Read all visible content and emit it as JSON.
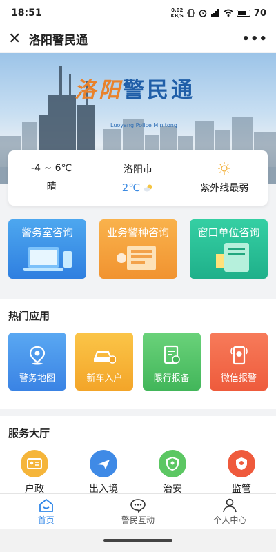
{
  "status": {
    "time": "18:51",
    "net_speed_value": "0.02",
    "net_speed_unit": "KB/S",
    "battery": "70"
  },
  "titlebar": {
    "title": "洛阳警民通"
  },
  "banner": {
    "title_orange": "洛阳",
    "title_blue": "警民通",
    "subtitle": "Luoyang Police Minitong"
  },
  "weather": {
    "temp_range": "-4 ~ 6℃",
    "condition": "晴",
    "city": "洛阳市",
    "current_temp": "2℃",
    "uv": "紫外线最弱"
  },
  "quick_cards": [
    {
      "label": "警务室咨询",
      "color": "#3a8fe7"
    },
    {
      "label": "业务警种咨询",
      "color": "#f4a13c"
    },
    {
      "label": "窗口单位咨询",
      "color": "#27bf96"
    }
  ],
  "hot_apps": {
    "title": "热门应用",
    "items": [
      {
        "label": "警务地图",
        "icon": "map-pin-icon"
      },
      {
        "label": "新车入户",
        "icon": "car-icon"
      },
      {
        "label": "限行报备",
        "icon": "clipboard-icon"
      },
      {
        "label": "微信报警",
        "icon": "phone-alert-icon"
      }
    ]
  },
  "service_hall": {
    "title": "服务大厅",
    "items": [
      {
        "label": "户政",
        "color": "#f5b53a"
      },
      {
        "label": "出入境",
        "color": "#3f8ae6"
      },
      {
        "label": "治安",
        "color": "#5cc763"
      },
      {
        "label": "监管",
        "color": "#ef5a3c"
      }
    ]
  },
  "tabbar": {
    "items": [
      {
        "label": "首页",
        "active": true
      },
      {
        "label": "警民互动",
        "active": false
      },
      {
        "label": "个人中心",
        "active": false
      }
    ]
  }
}
